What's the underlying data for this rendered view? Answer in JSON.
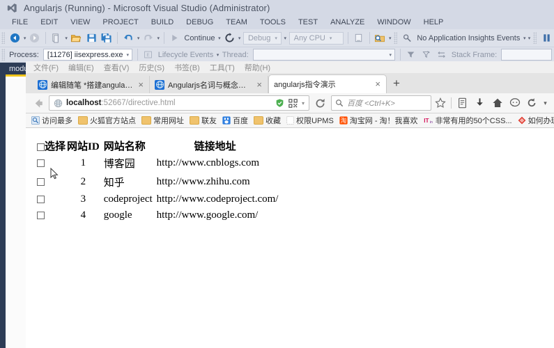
{
  "vs": {
    "title": "Angularjs (Running) - Microsoft Visual Studio (Administrator)",
    "logo_icon": "visual-studio-logo",
    "menu": [
      "FILE",
      "EDIT",
      "VIEW",
      "PROJECT",
      "BUILD",
      "DEBUG",
      "TEAM",
      "TOOLS",
      "TEST",
      "ANALYZE",
      "WINDOW",
      "HELP"
    ],
    "toolbar": {
      "nav_back_icon": "navigate-back-icon",
      "nav_forward_icon": "navigate-forward-icon",
      "new_item_icon": "new-item-icon",
      "open_file_icon": "open-file-icon",
      "save_icon": "save-icon",
      "save_all_icon": "save-all-icon",
      "undo_icon": "undo-icon",
      "redo_icon": "redo-icon",
      "play_icon": "continue-play-icon",
      "continue_label": "Continue",
      "restart_icon": "restart-icon",
      "config_value": "Debug",
      "platform_value": "Any CPU",
      "attach_icon": "attach-to-process-icon",
      "insights_icon": "application-insights-icon",
      "insights_label": "No Application Insights Events",
      "pause_icon": "pause-icon"
    },
    "debugbar": {
      "process_label": "Process:",
      "process_value": "[11276] iisexpress.exe",
      "lifecycle_icon": "lifecycle-events-icon",
      "lifecycle_label": "Lifecycle Events",
      "thread_label": "Thread:",
      "thread_value": "",
      "filter_icon": "filter-icon",
      "clear_filter_icon": "clear-filter-icon",
      "swap_icon": "swap-threads-icon",
      "stackframe_label": "Stack Frame:",
      "stackframe_value": ""
    },
    "editor_tab_label": "modu"
  },
  "browser": {
    "menu": [
      "文件(F)",
      "编辑(E)",
      "查看(V)",
      "历史(S)",
      "书签(B)",
      "工具(T)",
      "帮助(H)"
    ],
    "tabs": [
      {
        "title": "编辑随笔 *搭建angularjs ...",
        "favicon": "globe-favicon",
        "close_icon": "close-icon",
        "active": false
      },
      {
        "title": "Angularjs名词与概念（二...",
        "favicon": "globe-favicon",
        "close_icon": "close-icon",
        "active": false
      },
      {
        "title": "angularjs指令演示",
        "favicon": "",
        "close_icon": "close-icon",
        "active": true
      }
    ],
    "new_tab_label": "+",
    "nav": {
      "back_icon": "back-arrow-icon",
      "url_globe_icon": "globe-icon",
      "url_host": "localhost",
      "url_rest": ":52667/directive.html",
      "shield_icon": "shield-icon",
      "qr_icon": "qr-code-icon",
      "dropdown_icon": "chevron-down-icon",
      "reload_icon": "reload-icon",
      "search_icon": "search-icon",
      "search_placeholder": "百度 <Ctrl+K>",
      "bookmark_star_icon": "bookmark-star-icon",
      "reader_icon": "reader-view-icon",
      "download_icon": "download-icon",
      "home_icon": "home-icon",
      "chat_icon": "chat-icon",
      "sync_icon": "sync-icon",
      "overflow_icon": "chevron-down-icon"
    },
    "bookmarks": [
      {
        "label": "访问最多",
        "icon": "most-visited-icon"
      },
      {
        "label": "火狐官方站点",
        "icon": "folder-icon"
      },
      {
        "label": "常用网址",
        "icon": "folder-icon"
      },
      {
        "label": "联友",
        "icon": "folder-icon"
      },
      {
        "label": "百度",
        "icon": "baidu-icon"
      },
      {
        "label": "收藏",
        "icon": "folder-icon"
      },
      {
        "label": "权限UPMS",
        "icon": "blank-page-icon"
      },
      {
        "label": "淘宝网 - 淘！我喜欢",
        "icon": "taobao-icon"
      },
      {
        "label": "非常有用的50个CSS...",
        "icon": "itin-icon"
      },
      {
        "label": "如何办理提现",
        "icon": "red-diamond-icon"
      }
    ]
  },
  "page": {
    "table": {
      "headers": [
        "选择",
        "网站ID",
        "网站名称",
        "链接地址"
      ],
      "header_checkbox_icon": "checkbox-unchecked",
      "rows": [
        {
          "checkbox_icon": "checkbox-unchecked",
          "id": "1",
          "name": "博客园",
          "url": "http://www.cnblogs.com"
        },
        {
          "checkbox_icon": "checkbox-unchecked",
          "id": "2",
          "name": "知乎",
          "url": "http://www.zhihu.com"
        },
        {
          "checkbox_icon": "checkbox-unchecked",
          "id": "3",
          "name": "codeproject",
          "url": "http://www.codeproject.com/"
        },
        {
          "checkbox_icon": "checkbox-unchecked",
          "id": "4",
          "name": "google",
          "url": "http://www.google.com/"
        }
      ]
    },
    "cursor_icon": "mouse-pointer-arrow"
  }
}
